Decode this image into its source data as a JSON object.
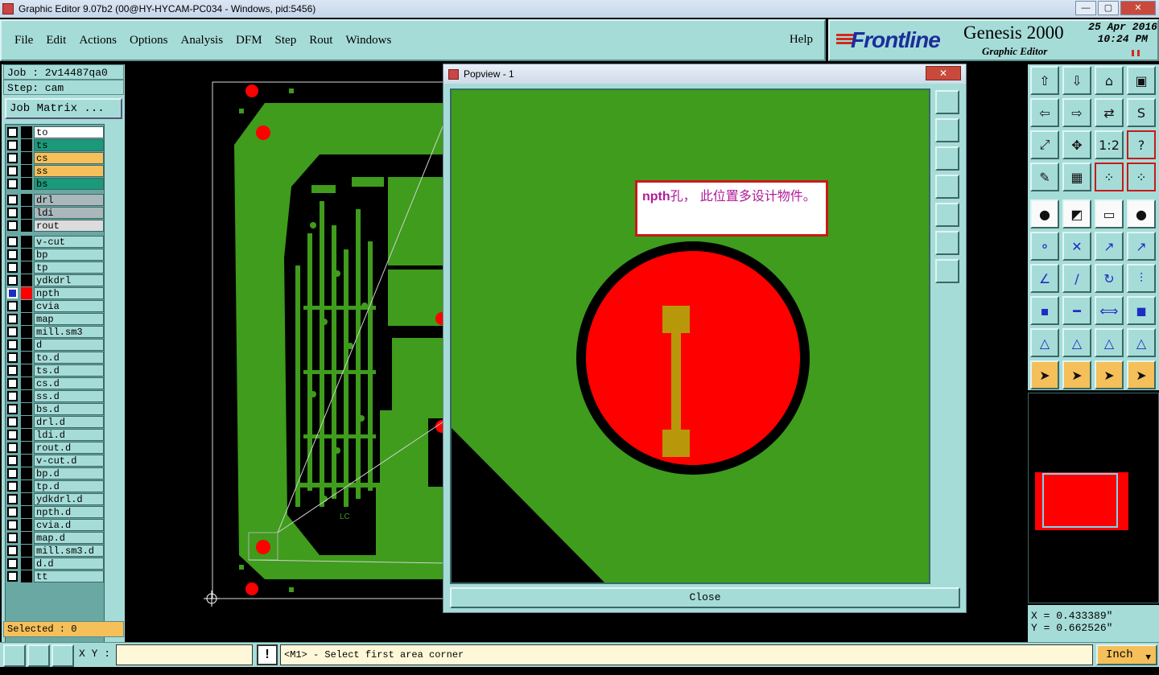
{
  "window": {
    "title": "Graphic Editor 9.07b2 (00@HY-HYCAM-PC034 - Windows, pid:5456)"
  },
  "menu": [
    "File",
    "Edit",
    "Actions",
    "Options",
    "Analysis",
    "DFM",
    "Step",
    "Rout",
    "Windows"
  ],
  "help_label": "Help",
  "brand": {
    "logo": "Frontline",
    "product": "Genesis 2000",
    "subtitle": "Graphic Editor",
    "date": "25 Apr 2016",
    "time": "10:24 PM"
  },
  "job": {
    "job_label": "Job : 2v14487qa0",
    "step_label": "Step: cam",
    "matrix_button": "Job Matrix ..."
  },
  "layers": [
    {
      "name": "to",
      "color": "#ffffff",
      "active": false
    },
    {
      "name": "ts",
      "color": "#1a9a7a",
      "active": false
    },
    {
      "name": "cs",
      "color": "#f5bf5a",
      "active": false
    },
    {
      "name": "ss",
      "color": "#f5bf5a",
      "active": false
    },
    {
      "name": "bs",
      "color": "#1a9a7a",
      "active": false
    },
    {
      "name": "drl",
      "color": "#aab8bc",
      "active": false
    },
    {
      "name": "ldi",
      "color": "#aab8bc",
      "active": false
    },
    {
      "name": "rout",
      "color": "#dcdcdc",
      "active": false
    },
    {
      "name": "v-cut",
      "color": "#a6dcd8",
      "active": false
    },
    {
      "name": "bp",
      "color": "#a6dcd8",
      "active": false
    },
    {
      "name": "tp",
      "color": "#a6dcd8",
      "active": false
    },
    {
      "name": "ydkdrl",
      "color": "#a6dcd8",
      "active": false
    },
    {
      "name": "npth",
      "color": "#a6dcd8",
      "active": true
    },
    {
      "name": "cvia",
      "color": "#a6dcd8",
      "active": false
    },
    {
      "name": "map",
      "color": "#a6dcd8",
      "active": false
    },
    {
      "name": "mill.sm3",
      "color": "#a6dcd8",
      "active": false
    },
    {
      "name": "d",
      "color": "#a6dcd8",
      "active": false
    },
    {
      "name": "to.d",
      "color": "#a6dcd8",
      "active": false
    },
    {
      "name": "ts.d",
      "color": "#a6dcd8",
      "active": false
    },
    {
      "name": "cs.d",
      "color": "#a6dcd8",
      "active": false
    },
    {
      "name": "ss.d",
      "color": "#a6dcd8",
      "active": false
    },
    {
      "name": "bs.d",
      "color": "#a6dcd8",
      "active": false
    },
    {
      "name": "drl.d",
      "color": "#a6dcd8",
      "active": false
    },
    {
      "name": "ldi.d",
      "color": "#a6dcd8",
      "active": false
    },
    {
      "name": "rout.d",
      "color": "#a6dcd8",
      "active": false
    },
    {
      "name": "v-cut.d",
      "color": "#a6dcd8",
      "active": false
    },
    {
      "name": "bp.d",
      "color": "#a6dcd8",
      "active": false
    },
    {
      "name": "tp.d",
      "color": "#a6dcd8",
      "active": false
    },
    {
      "name": "ydkdrl.d",
      "color": "#a6dcd8",
      "active": false
    },
    {
      "name": "npth.d",
      "color": "#a6dcd8",
      "active": false
    },
    {
      "name": "cvia.d",
      "color": "#a6dcd8",
      "active": false
    },
    {
      "name": "map.d",
      "color": "#a6dcd8",
      "active": false
    },
    {
      "name": "mill.sm3.d",
      "color": "#a6dcd8",
      "active": false
    },
    {
      "name": "d.d",
      "color": "#a6dcd8",
      "active": false
    },
    {
      "name": "tt",
      "color": "#a6dcd8",
      "active": false
    }
  ],
  "selected_label": "Selected : 0",
  "popview": {
    "title": "Popview - 1",
    "note_strong": "npth",
    "note_text": "孔， 此位置多设计物件。",
    "close_label": "Close"
  },
  "canvas": {
    "board_text": "LC"
  },
  "coords": {
    "x": "X = 0.433389\"",
    "y": "Y = 0.662526\""
  },
  "bottom": {
    "xy_label": "X Y :",
    "xy_value": "",
    "message": "<M1> - Select first area corner",
    "unit": "Inch"
  },
  "colors": {
    "panel": "#a6dcd8",
    "copper": "#3f9c1c",
    "pad": "#ff0000",
    "accent": "#f5bf5a"
  }
}
